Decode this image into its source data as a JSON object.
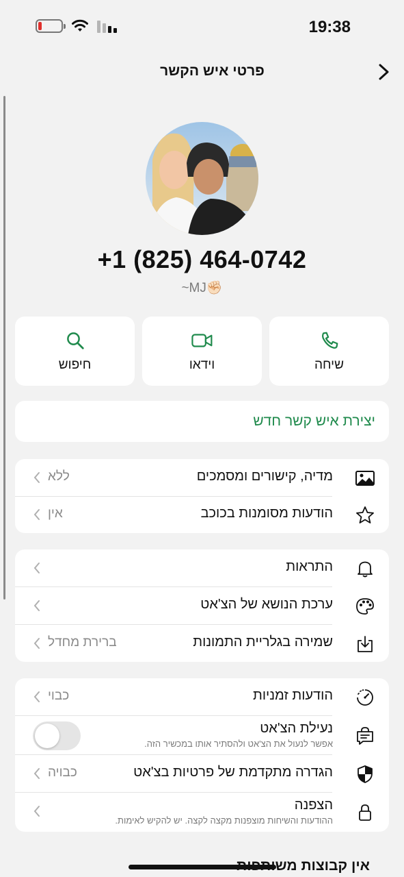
{
  "status_bar": {
    "time": "19:38",
    "battery_color": "#e0302c"
  },
  "header": {
    "title": "פרטי איש הקשר",
    "back_icon": "chevron-right-icon"
  },
  "profile": {
    "phone": "+1 (825) 464-0742",
    "name": "~MJ✊🏻"
  },
  "actions": [
    {
      "label": "שיחה",
      "icon": "phone-icon"
    },
    {
      "label": "וידאו",
      "icon": "video-icon"
    },
    {
      "label": "חיפוש",
      "icon": "search-icon"
    }
  ],
  "new_contact": {
    "label": "יצירת איש קשר חדש",
    "color": "#1f8a4c"
  },
  "section_media": [
    {
      "label": "מדיה, קישורים ומסמכים",
      "value": "ללא",
      "icon": "image-icon"
    },
    {
      "label": "הודעות מסומנות בכוכב",
      "value": "אין",
      "icon": "star-icon"
    }
  ],
  "section_settings": [
    {
      "label": "התראות",
      "value": "",
      "icon": "bell-icon"
    },
    {
      "label": "ערכת הנושא של הצ'אט",
      "value": "",
      "icon": "palette-icon"
    },
    {
      "label": "שמירה בגלריית התמונות",
      "value": "ברירת מחדל",
      "icon": "download-icon"
    }
  ],
  "section_privacy": {
    "disappearing": {
      "label": "הודעות זמניות",
      "value": "כבוי",
      "icon": "timer-icon"
    },
    "chat_lock": {
      "label": "נעילת הצ'אט",
      "subtitle": "אפשר לנעול את הצ'אט ולהסתיר אותו במכשיר הזה.",
      "toggle_on": false,
      "icon": "chat-lock-icon"
    },
    "advanced_privacy": {
      "label": "הגדרה מתקדמת של פרטיות בצ'אט",
      "value": "כבויה",
      "icon": "shield-icon"
    },
    "encryption": {
      "label": "הצפנה",
      "subtitle": "ההודעות והשיחות מוצפנות מקצה לקצה. יש להקיש לאימות.",
      "icon": "lock-icon"
    }
  },
  "groups_heading": "אין קבוצות משותפות"
}
